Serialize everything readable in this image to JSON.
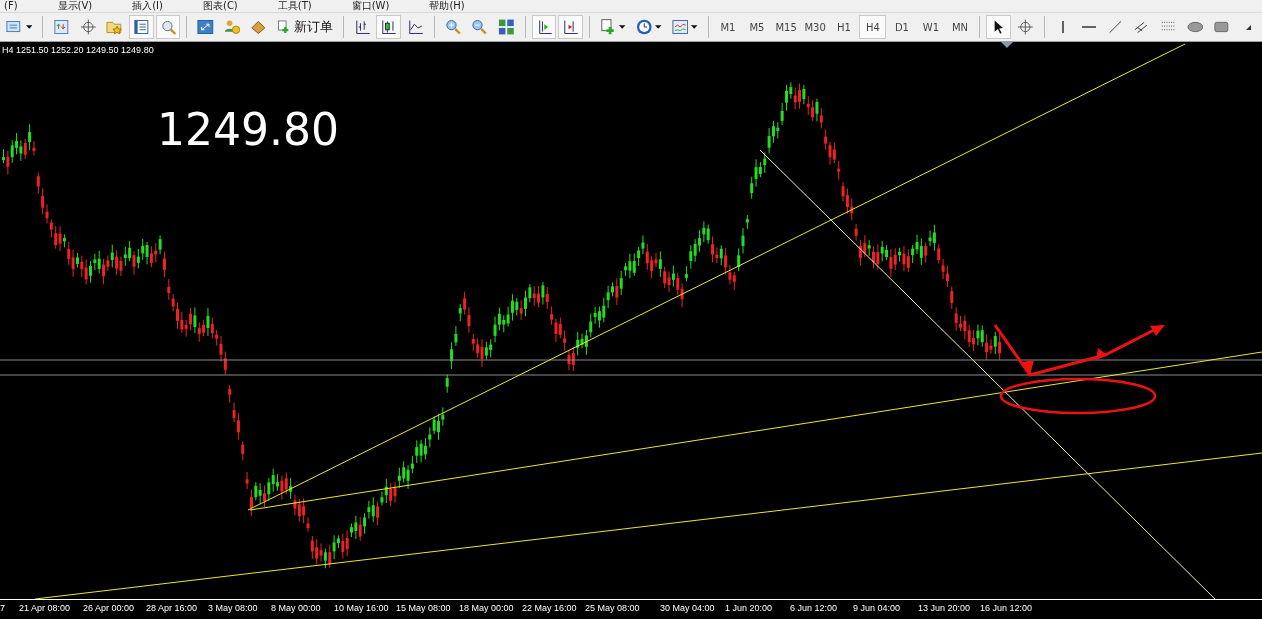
{
  "menu": [
    "(F)",
    "显示(V)",
    "插入(I)",
    "图表(C)",
    "工具(T)",
    "窗口(W)",
    "帮助(H)"
  ],
  "toolbar": [
    {
      "kind": "profiles",
      "pressed": false
    },
    {
      "kind": "market-watch",
      "pressed": false
    },
    {
      "kind": "crosshair",
      "pressed": false
    },
    {
      "kind": "favorites",
      "pressed": false
    },
    {
      "kind": "navigator",
      "pressed": true
    },
    {
      "kind": "tester",
      "pressed": true
    },
    {
      "kind": "fullscreen",
      "pressed": false
    },
    {
      "kind": "experts",
      "pressed": false
    },
    {
      "kind": "folder",
      "pressed": false
    }
  ],
  "new_order": {
    "label": "新订单"
  },
  "chart_tools": [
    {
      "kind": "bars",
      "pressed": false
    },
    {
      "kind": "candles",
      "pressed": true
    },
    {
      "kind": "line",
      "pressed": false
    },
    {
      "kind": "zoom-in",
      "pressed": false
    },
    {
      "kind": "zoom-out",
      "pressed": false
    },
    {
      "kind": "tile",
      "pressed": false
    },
    {
      "kind": "autoscroll",
      "pressed": true
    },
    {
      "kind": "shift",
      "pressed": true
    },
    {
      "kind": "indicators",
      "pressed": false
    },
    {
      "kind": "clock",
      "pressed": false
    },
    {
      "kind": "template",
      "pressed": false
    }
  ],
  "timeframes": [
    {
      "label": "M1",
      "selected": false
    },
    {
      "label": "M5",
      "selected": false
    },
    {
      "label": "M15",
      "selected": false
    },
    {
      "label": "M30",
      "selected": false
    },
    {
      "label": "H1",
      "selected": false
    },
    {
      "label": "H4",
      "selected": true
    },
    {
      "label": "D1",
      "selected": false
    },
    {
      "label": "W1",
      "selected": false
    },
    {
      "label": "MN",
      "selected": false
    }
  ],
  "draw_tools": [
    {
      "kind": "cursor",
      "pressed": true
    },
    {
      "kind": "crosshair",
      "pressed": false
    },
    {
      "kind": "vline",
      "pressed": false
    },
    {
      "kind": "hline",
      "pressed": false
    },
    {
      "kind": "trendline",
      "pressed": false
    },
    {
      "kind": "channel",
      "pressed": false
    },
    {
      "kind": "fibo",
      "pressed": false
    },
    {
      "kind": "ellipse",
      "pressed": false
    },
    {
      "kind": "rectangle",
      "pressed": false
    },
    {
      "kind": "more",
      "pressed": false
    }
  ],
  "chart": {
    "info": "H4  1251.50 1252.20 1249.50 1249.80",
    "price": "1249.80",
    "time_labels": [
      "7",
      "21 Apr 08:00",
      "26 Apr 00:00",
      "28 Apr 16:00",
      "3 May 08:00",
      "8 May 00:00",
      "10 May 16:00",
      "15 May 08:00",
      "18 May 00:00",
      "22 May 16:00",
      "25 May 08:00",
      "30 May 04:00",
      "1 Jun 20:00",
      "6 Jun 12:00",
      "9 Jun 04:00",
      "13 Jun 20:00",
      "16 Jun 12:00"
    ]
  }
}
